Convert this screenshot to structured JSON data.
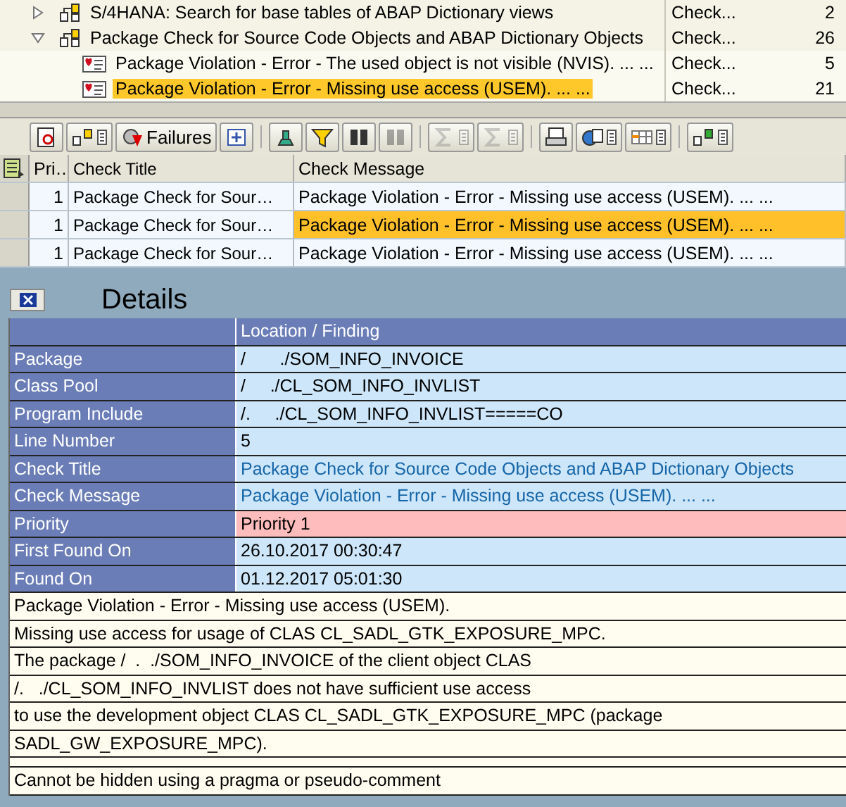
{
  "tree": [
    {
      "label": "S/4HANA: Search for base tables of ABAP Dictionary views",
      "type": "Check...",
      "count": "2",
      "expanded": false,
      "selected": false
    },
    {
      "label": "Package Check for Source Code Objects and ABAP Dictionary Objects",
      "type": "Check...",
      "count": "26",
      "expanded": true,
      "selected": false,
      "children": [
        {
          "label": "Package Violation - Error - The used object is not visible (NVIS). ... ...",
          "type": "Check...",
          "count": "5",
          "selected": false
        },
        {
          "label": "Package Violation - Error - Missing use access (USEM). ... ...",
          "type": "Check...",
          "count": "21",
          "selected": true
        }
      ]
    }
  ],
  "toolbar": [
    [
      {
        "disabled": false,
        "dropdown": false
      },
      {
        "disabled": false,
        "dropdown": true
      },
      {
        "label": "Failures",
        "disabled": false,
        "dropdown": false
      },
      {
        "disabled": false,
        "dropdown": false
      }
    ],
    [
      {
        "disabled": false,
        "dropdown": false
      },
      {
        "disabled": false,
        "dropdown": false
      },
      {
        "disabled": false,
        "dropdown": false
      },
      {
        "disabled": true,
        "dropdown": false
      }
    ],
    [
      {
        "disabled": true,
        "dropdown": true
      },
      {
        "disabled": true,
        "dropdown": true
      }
    ],
    [
      {
        "disabled": false,
        "dropdown": false
      },
      {
        "disabled": false,
        "dropdown": true
      },
      {
        "disabled": false,
        "dropdown": true
      }
    ],
    [
      {
        "disabled": false,
        "dropdown": true
      }
    ]
  ],
  "grid": {
    "columns": [
      "Pri…",
      "Check Title",
      "Check Message"
    ],
    "rows": [
      {
        "priority": "1",
        "title": "Package Check for Sour…",
        "message": "Package Violation - Error - Missing use access (USEM). ... ...",
        "selected": false
      },
      {
        "priority": "1",
        "title": "Package Check for Sour…",
        "message": "Package Violation - Error - Missing use access (USEM). ... ...",
        "selected": true
      },
      {
        "priority": "1",
        "title": "Package Check for Sour…",
        "message": "Package Violation - Error - Missing use access (USEM). ... ...",
        "selected": false
      }
    ]
  },
  "details": {
    "title": "Details",
    "column_heading": "Location / Finding",
    "fields": [
      {
        "label": "Package",
        "value": "/       ./SOM_INFO_INVOICE",
        "kind": "plain"
      },
      {
        "label": "Class Pool",
        "value": "/     ./CL_SOM_INFO_INVLIST",
        "kind": "plain"
      },
      {
        "label": "Program Include",
        "value": "/.     ./CL_SOM_INFO_INVLIST=====CO",
        "kind": "plain"
      },
      {
        "label": "Line Number",
        "value": "5",
        "kind": "plain"
      },
      {
        "label": "Check Title",
        "value": "Package Check for Source Code Objects and ABAP Dictionary Objects",
        "kind": "link"
      },
      {
        "label": "Check Message",
        "value": "Package Violation - Error - Missing use access (USEM). ... ...",
        "kind": "link"
      },
      {
        "label": "Priority",
        "value": "Priority 1",
        "kind": "priority"
      },
      {
        "label": "First Found On",
        "value": "26.10.2017 00:30:47",
        "kind": "plain"
      },
      {
        "label": "Found On",
        "value": "01.12.2017 05:01:30",
        "kind": "plain"
      }
    ],
    "message_lines": [
      "Package Violation - Error - Missing use access (USEM).",
      "Missing use access for usage of CLAS CL_SADL_GTK_EXPOSURE_MPC.",
      "The package /  .  ./SOM_INFO_INVOICE of the client object CLAS",
      "/.   ./CL_SOM_INFO_INVLIST does not have sufficient use access",
      "to use the development object CLAS CL_SADL_GTK_EXPOSURE_MPC (package",
      "SADL_GW_EXPOSURE_MPC)."
    ],
    "note": "Cannot be hidden using a pragma or pseudo-comment"
  }
}
